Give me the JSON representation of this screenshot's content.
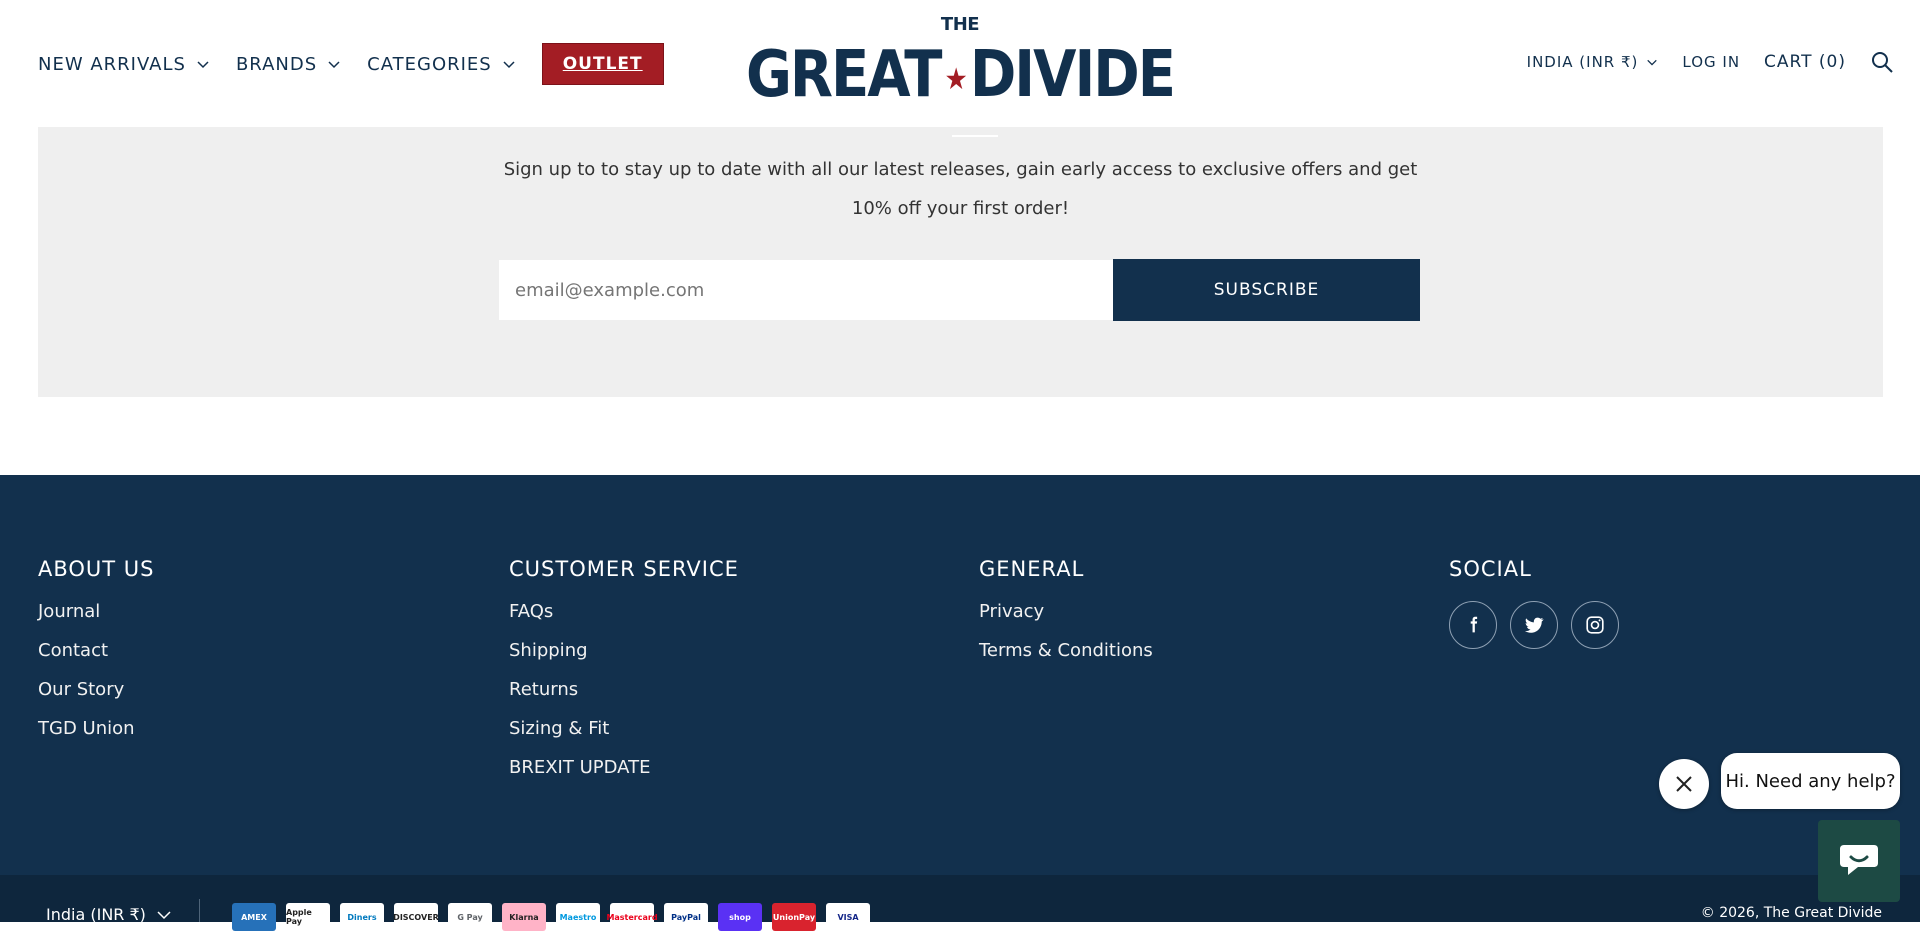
{
  "header": {
    "nav": [
      {
        "label": "NEW ARRIVALS"
      },
      {
        "label": "BRANDS"
      },
      {
        "label": "CATEGORIES"
      }
    ],
    "outlet_label": "OUTLET",
    "logo": {
      "top": "THE",
      "left": "GREAT",
      "right": "DIVIDE",
      "star": "★"
    },
    "currency": "INDIA (INR ₹)",
    "login": "LOG IN",
    "cart": "CART (0)"
  },
  "newsletter": {
    "line1": "Sign up to to stay up to date with all our latest releases, gain early access to exclusive offers and get",
    "line2": "10% off your first order!",
    "email_placeholder": "email@example.com",
    "subscribe_label": "SUBSCRIBE"
  },
  "footer": {
    "about": {
      "title": "ABOUT US",
      "links": [
        "Journal",
        "Contact",
        "Our Story",
        "TGD Union"
      ]
    },
    "service": {
      "title": "CUSTOMER SERVICE",
      "links": [
        "FAQs",
        "Shipping",
        "Returns",
        "Sizing & Fit",
        "BREXIT UPDATE"
      ]
    },
    "general": {
      "title": "GENERAL",
      "links": [
        "Privacy",
        "Terms & Conditions"
      ]
    },
    "social": {
      "title": "SOCIAL",
      "icons": [
        "facebook-icon",
        "twitter-icon",
        "instagram-icon"
      ]
    }
  },
  "chat": {
    "message": "Hi. Need any help?"
  },
  "bottom": {
    "currency": "India (INR ₹)",
    "payments": [
      "AMEX",
      "Apple Pay",
      "Diners",
      "DISCOVER",
      "G Pay",
      "Klarna",
      "Maestro",
      "Mastercard",
      "PayPal",
      "shop",
      "UnionPay",
      "VISA"
    ],
    "copyright": "© 2026, The Great Divide"
  },
  "colors": {
    "navy": "#12304d",
    "outlet_red": "#a31d24",
    "chat_green": "#1d4a44",
    "newsletter_bg": "#efefef"
  }
}
